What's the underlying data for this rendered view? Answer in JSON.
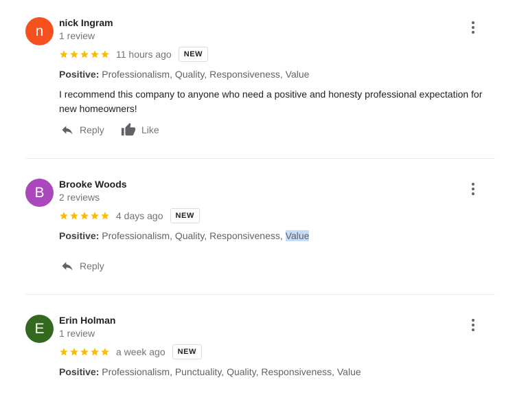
{
  "reviews": [
    {
      "initial": "n",
      "avatar_color": "#f4511e",
      "name": "nick Ingram",
      "review_count": "1 review",
      "rating": 5,
      "time": "11 hours ago",
      "badge": "NEW",
      "positive_label": "Positive:",
      "positive_items": "Professionalism, Quality, Responsiveness, Value",
      "text": "I recommend this company to anyone who need a positive and honesty professional expectation for new homeowners!",
      "reply_label": "Reply",
      "like_label": "Like"
    },
    {
      "initial": "B",
      "avatar_color": "#ab47bc",
      "name": "Brooke Woods",
      "review_count": "2 reviews",
      "rating": 5,
      "time": "4 days ago",
      "badge": "NEW",
      "positive_label": "Positive:",
      "positive_items_prefix": "Professionalism, Quality, Responsiveness, ",
      "positive_items_highlight": "Value",
      "reply_label": "Reply"
    },
    {
      "initial": "E",
      "avatar_color": "#33691e",
      "name": "Erin Holman",
      "review_count": "1 review",
      "rating": 5,
      "time": "a week ago",
      "badge": "NEW",
      "positive_label": "Positive:",
      "positive_items": "Professionalism, Punctuality, Quality, Responsiveness, Value"
    }
  ],
  "colors": {
    "star": "#fbbc04",
    "secondary_text": "#70757a",
    "selection_highlight": "#c7dcf7"
  },
  "icons": {
    "star": "star-icon",
    "reply": "reply-icon",
    "like": "thumb-up-icon",
    "menu": "more-vert-icon"
  }
}
